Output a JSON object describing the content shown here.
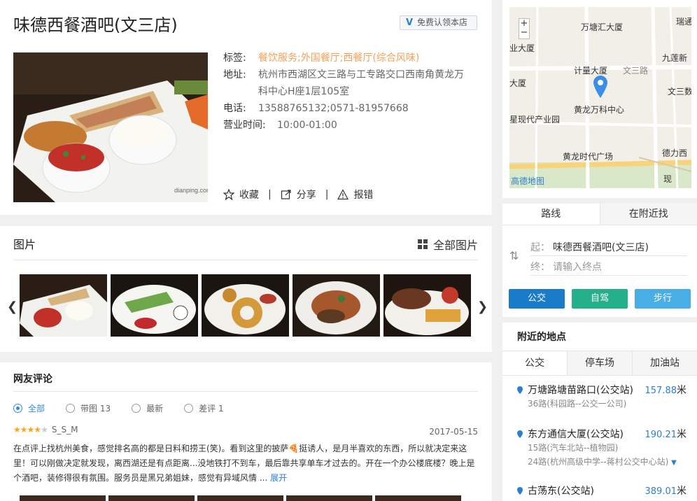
{
  "header": {
    "title": "味德西餐酒吧(文三店)",
    "claim": "免费认领本店",
    "tags_label": "标签:",
    "tags_value": "餐饮服务;外国餐厅;西餐厅(综合风味)",
    "address_label": "地址:",
    "address_value": "杭州市西湖区文三路与工专路交口西南角黄龙万科中心H座1层105室",
    "phone_label": "电话:",
    "phone_value": "13588765132;0571-81957668",
    "hours_label": "营业时间:",
    "hours_value": "10:00-01:00",
    "actions": {
      "favorite": "收藏",
      "share": "分享",
      "report": "报错"
    },
    "photo_watermark": "大众点评"
  },
  "photos": {
    "title": "图片",
    "all": "全部图片"
  },
  "reviews": {
    "title": "网友评论",
    "filters": [
      "全部",
      "带图 13",
      "最新",
      "差评 1"
    ],
    "user": "S_S_M",
    "stars": 4,
    "date": "2017-05-15",
    "text": "在点评上找杭州美食，感觉排名高的都是日料和捞王(笑)。看到这里的披萨🍕挺诱人，是月半喜欢的东西，所以就决定来这里！可以刚做决定就发现，离西湖还是有点距离...没地铁打不到车，最后靠共享单车才过去的。开在一个办公楼底楼？晚上是个酒吧，装修得很有氛围。服务员是黑兄弟姐妹，感觉有异域风情 ...",
    "more": "展开"
  },
  "map": {
    "labels": [
      "万塘汇大厦",
      "瑞通",
      "业大厦",
      "九莲新",
      "计量大厦",
      "文三路",
      "大厦",
      "文三数",
      "黄龙万科中心",
      "星现代产业园",
      "德力西",
      "黄龙时代广场",
      "高德地图",
      "现"
    ],
    "zoom_in": "+",
    "zoom_out": "−"
  },
  "route": {
    "tabs": [
      "路线",
      "在附近找"
    ],
    "from_label": "起：",
    "from_value": "味德西餐酒吧(文三店)",
    "to_label": "终：",
    "to_placeholder": "请输入终点",
    "modes": [
      "公交",
      "自驾",
      "步行"
    ],
    "mode_colors": [
      "#1a7bc9",
      "#23b08a",
      "#4aaee6"
    ]
  },
  "nearby": {
    "title": "附近的地点",
    "tabs": [
      "公交",
      "停车场",
      "加油站"
    ],
    "stops": [
      {
        "name": "万塘路塘苗路口(公交站)",
        "dist": "157.88",
        "lines": [
          "36路(科园路--公交一公司)"
        ]
      },
      {
        "name": "东方通信大厦(公交站)",
        "dist": "190.21",
        "lines": [
          "15路(汽车北站--植物园)",
          "24路(杭州高级中学--蒋村公交中心站)"
        ]
      },
      {
        "name": "古荡东(公交站)",
        "dist": "389.01",
        "lines": []
      }
    ],
    "unit": "米"
  }
}
